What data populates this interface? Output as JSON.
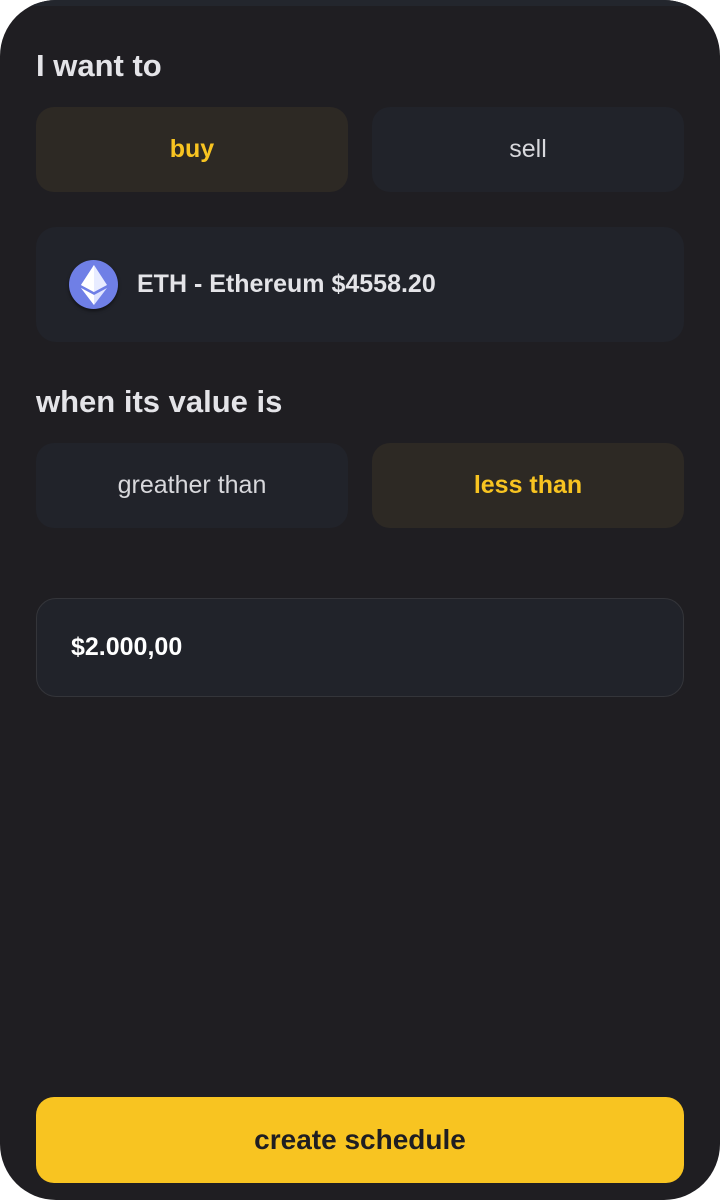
{
  "action_section": {
    "heading": "I want to",
    "options": [
      {
        "label": "buy",
        "selected": true
      },
      {
        "label": "sell",
        "selected": false
      }
    ]
  },
  "asset": {
    "label": "ETH - Ethereum $4558.20",
    "icon": "ethereum-icon"
  },
  "condition_section": {
    "heading": "when its value is",
    "options": [
      {
        "label": "greather than",
        "selected": false
      },
      {
        "label": "less than",
        "selected": true
      }
    ]
  },
  "amount": {
    "value": "$2.000,00"
  },
  "submit": {
    "label": "create schedule"
  },
  "colors": {
    "accent": "#f8c421",
    "background": "#1f1e22",
    "card": "#21232a"
  }
}
